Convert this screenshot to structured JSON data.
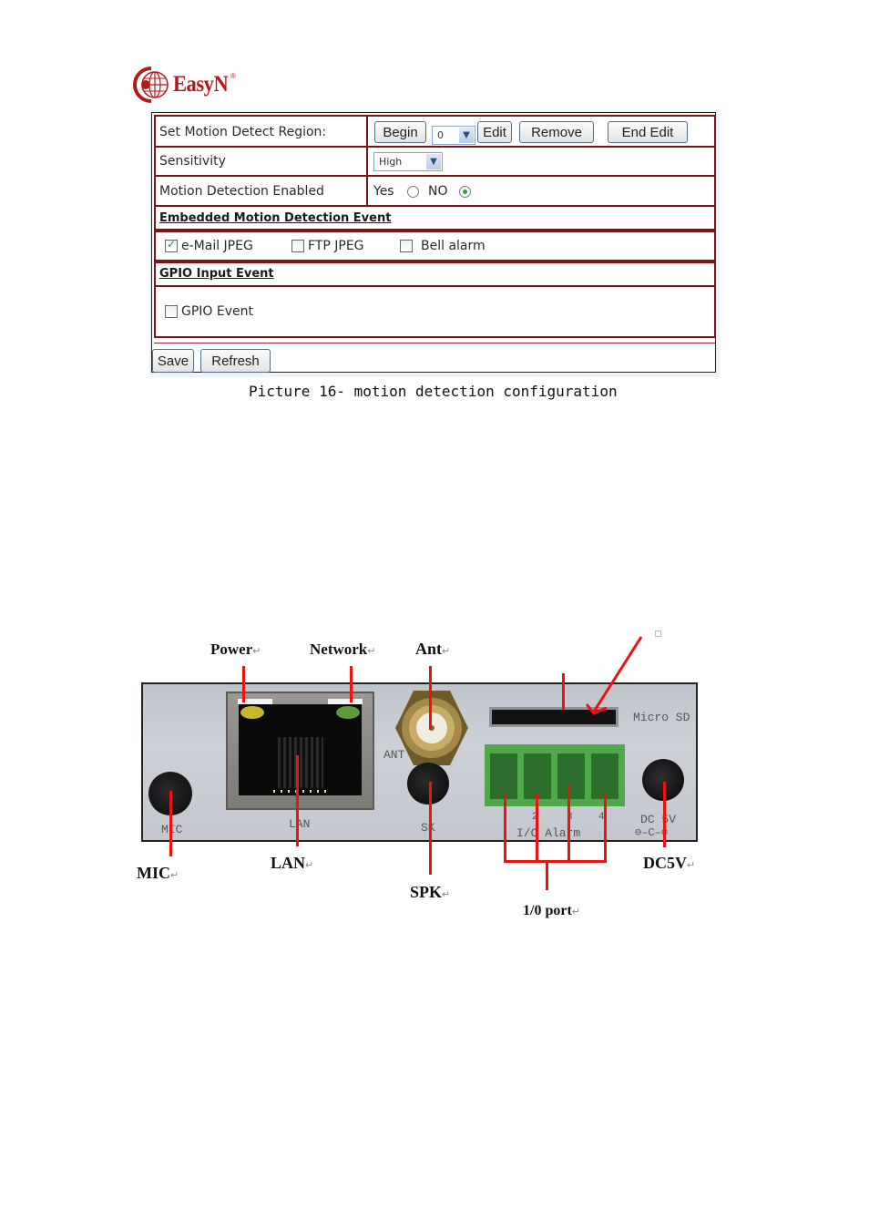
{
  "logo": {
    "brand": "EasyN",
    "registered": "®"
  },
  "config_panel": {
    "region_row": {
      "label": "Set Motion Detect Region:",
      "begin_button": "Begin",
      "region_select_value": "0",
      "edit_button": "Edit",
      "remove_button": "Remove",
      "end_edit_button": "End Edit"
    },
    "sensitivity_row": {
      "label": "Sensitivity",
      "select_value": "High"
    },
    "enabled_row": {
      "label": "Motion Detection Enabled",
      "yes_label": "Yes",
      "no_label": "NO",
      "selected": "NO"
    },
    "embedded_section": {
      "title": "Embedded Motion Detection Event",
      "options": [
        {
          "label": "e-Mail JPEG",
          "checked": true
        },
        {
          "label": "FTP JPEG",
          "checked": false
        },
        {
          "label": "Bell alarm",
          "checked": false
        }
      ]
    },
    "gpio_section": {
      "title": "GPIO Input Event",
      "options": [
        {
          "label": "GPIO Event",
          "checked": false
        }
      ]
    },
    "save_button": "Save",
    "refresh_button": "Refresh"
  },
  "caption": "Picture 16- motion detection configuration",
  "device_diagram": {
    "callouts": {
      "power": "Power",
      "network": "Network",
      "ant": "Ant",
      "mic": "MIC",
      "lan": "LAN",
      "spk": "SPK",
      "io_port": "1/0 port",
      "dc5v": "DC5V"
    },
    "return_mark": "↵",
    "silkscreen": {
      "ant": "ANT",
      "mic": "MIC",
      "lan": "LAN",
      "spk": "SK",
      "micro_sd": "Micro SD",
      "io_alarm": "I/O Alarm",
      "io_nums": [
        "1",
        "2",
        "3",
        "4"
      ],
      "dc": "DC  5V",
      "polarity": "⊖–C–⊕"
    },
    "colors": {
      "callout_line": "#ee1111",
      "terminal": "#4fa84a",
      "power_led": "#c9b62a",
      "network_led": "#5c9a3a"
    }
  }
}
